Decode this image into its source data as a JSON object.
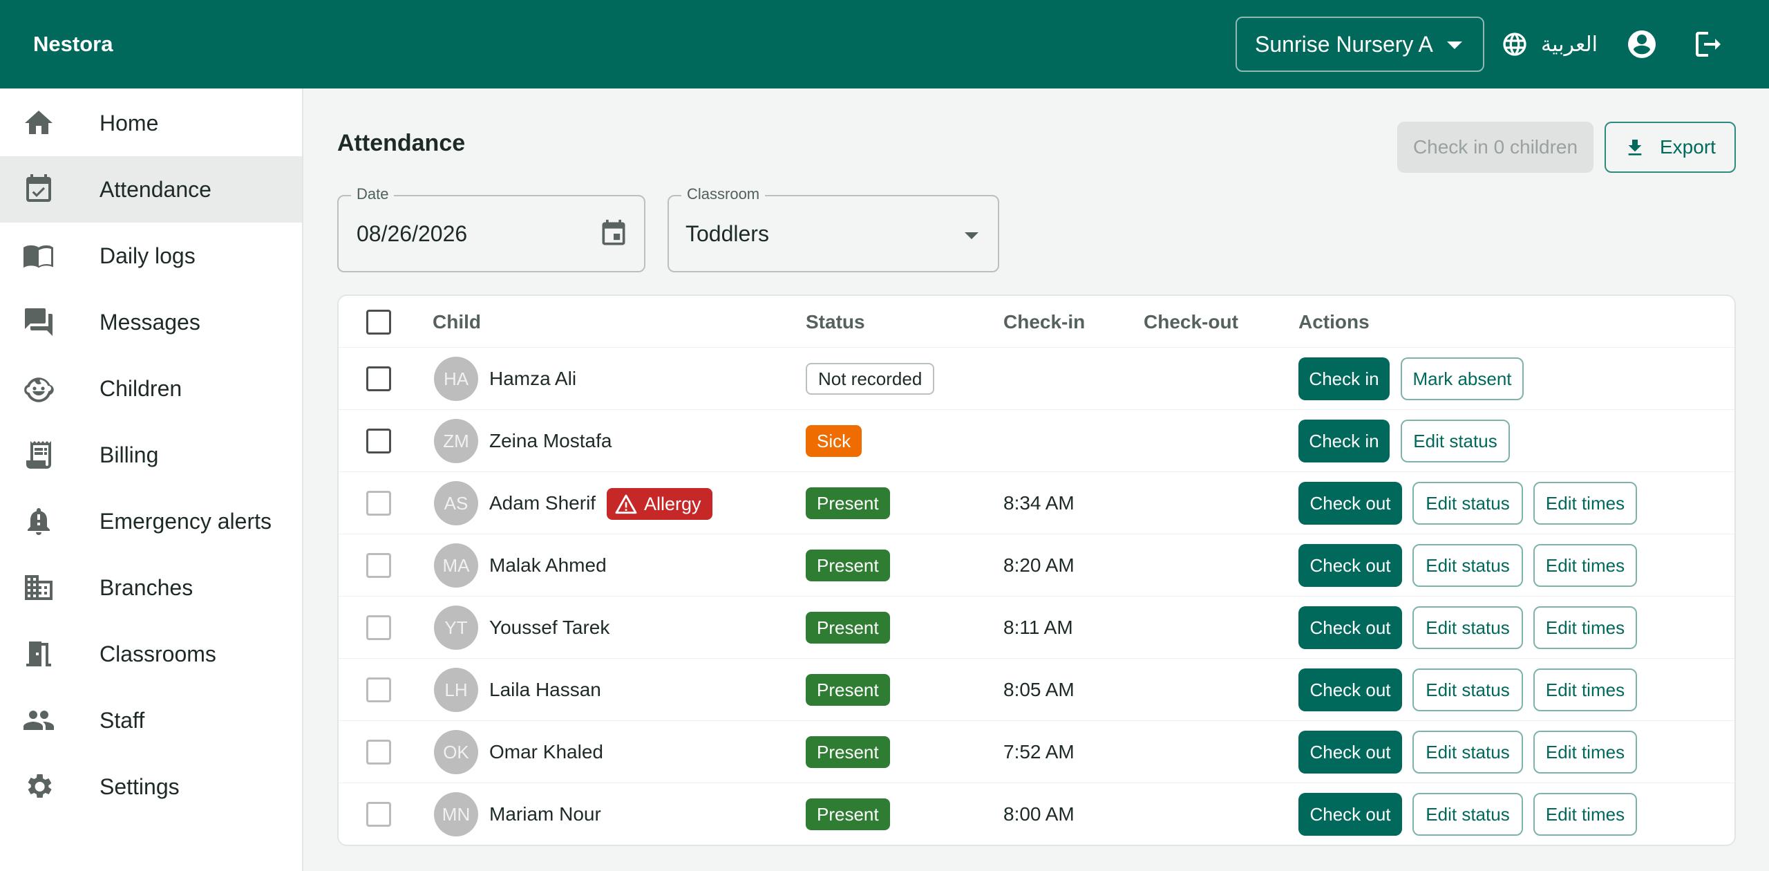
{
  "app": {
    "name": "Nestora"
  },
  "header": {
    "branch": "Sunrise Nursery A",
    "language_label": "العربية",
    "icons": [
      "globe-icon",
      "account-circle-icon",
      "logout-icon"
    ]
  },
  "sidebar": {
    "items": [
      {
        "label": "Home",
        "icon": "home-icon",
        "active": false
      },
      {
        "label": "Attendance",
        "icon": "event-available-icon",
        "active": true
      },
      {
        "label": "Daily logs",
        "icon": "menu-book-icon",
        "active": false
      },
      {
        "label": "Messages",
        "icon": "forum-icon",
        "active": false
      },
      {
        "label": "Children",
        "icon": "child-face-icon",
        "active": false
      },
      {
        "label": "Billing",
        "icon": "receipt-icon",
        "active": false
      },
      {
        "label": "Emergency alerts",
        "icon": "alert-bell-icon",
        "active": false
      },
      {
        "label": "Branches",
        "icon": "building-icon",
        "active": false
      },
      {
        "label": "Classrooms",
        "icon": "door-icon",
        "active": false
      },
      {
        "label": "Staff",
        "icon": "people-icon",
        "active": false
      },
      {
        "label": "Settings",
        "icon": "gear-icon",
        "active": false
      }
    ]
  },
  "main": {
    "title": "Attendance",
    "checkin_bulk_label": "Check in 0 children",
    "export_label": "Export",
    "filters": {
      "date_label": "Date",
      "date_value": "08/26/2026",
      "classroom_label": "Classroom",
      "classroom_value": "Toddlers"
    },
    "table": {
      "headers": {
        "child": "Child",
        "status": "Status",
        "checkin": "Check-in",
        "checkout": "Check-out",
        "actions": "Actions"
      },
      "rows": [
        {
          "initials": "HA",
          "name": "Hamza Ali",
          "allergy": "",
          "status": "Not recorded",
          "status_kind": "outline",
          "checkin": "",
          "checkout": "",
          "actions": [
            "Check in",
            "Mark absent"
          ]
        },
        {
          "initials": "ZM",
          "name": "Zeina Mostafa",
          "allergy": "",
          "status": "Sick",
          "status_kind": "sick",
          "checkin": "",
          "checkout": "",
          "actions": [
            "Check in",
            "Edit status"
          ]
        },
        {
          "initials": "AS",
          "name": "Adam Sherif",
          "allergy": "Allergy",
          "status": "Present",
          "status_kind": "present",
          "checkin": "8:34 AM",
          "checkout": "",
          "actions": [
            "Check out",
            "Edit status",
            "Edit times"
          ]
        },
        {
          "initials": "MA",
          "name": "Malak Ahmed",
          "allergy": "",
          "status": "Present",
          "status_kind": "present",
          "checkin": "8:20 AM",
          "checkout": "",
          "actions": [
            "Check out",
            "Edit status",
            "Edit times"
          ]
        },
        {
          "initials": "YT",
          "name": "Youssef Tarek",
          "allergy": "",
          "status": "Present",
          "status_kind": "present",
          "checkin": "8:11 AM",
          "checkout": "",
          "actions": [
            "Check out",
            "Edit status",
            "Edit times"
          ]
        },
        {
          "initials": "LH",
          "name": "Laila Hassan",
          "allergy": "",
          "status": "Present",
          "status_kind": "present",
          "checkin": "8:05 AM",
          "checkout": "",
          "actions": [
            "Check out",
            "Edit status",
            "Edit times"
          ]
        },
        {
          "initials": "OK",
          "name": "Omar Khaled",
          "allergy": "",
          "status": "Present",
          "status_kind": "present",
          "checkin": "7:52 AM",
          "checkout": "",
          "actions": [
            "Check out",
            "Edit status",
            "Edit times"
          ]
        },
        {
          "initials": "MN",
          "name": "Mariam Nour",
          "allergy": "",
          "status": "Present",
          "status_kind": "present",
          "checkin": "8:00 AM",
          "checkout": "",
          "actions": [
            "Check out",
            "Edit status",
            "Edit times"
          ]
        }
      ]
    }
  },
  "colors": {
    "brand": "#00695c",
    "present": "#2e7d32",
    "sick": "#ef6c00",
    "allergy": "#c62828"
  }
}
